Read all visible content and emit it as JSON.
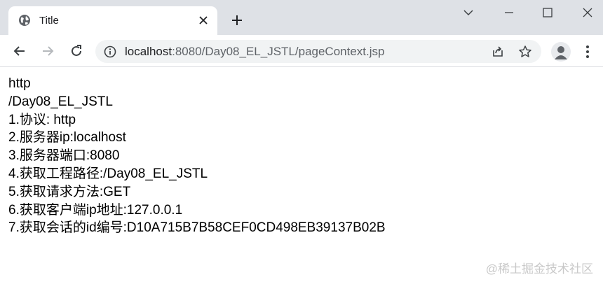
{
  "tab": {
    "title": "Title",
    "favicon": "globe-icon"
  },
  "window_controls": [
    "chevron-down-icon",
    "minimize-icon",
    "maximize-icon",
    "close-icon"
  ],
  "toolbar": {
    "url_host": "localhost",
    "url_rest": ":8080/Day08_EL_JSTL/pageContext.jsp"
  },
  "page": {
    "lines": [
      "http",
      "/Day08_EL_JSTL",
      "1.协议: http",
      "2.服务器ip:localhost",
      "3.服务器端口:8080",
      "4.获取工程路径:/Day08_EL_JSTL",
      "5.获取请求方法:GET",
      "6.获取客户端ip地址:127.0.0.1",
      "7.获取会话的id编号:D10A715B7B58CEF0CD498EB39137B02B"
    ]
  },
  "watermark": "@稀土掘金技术社区"
}
